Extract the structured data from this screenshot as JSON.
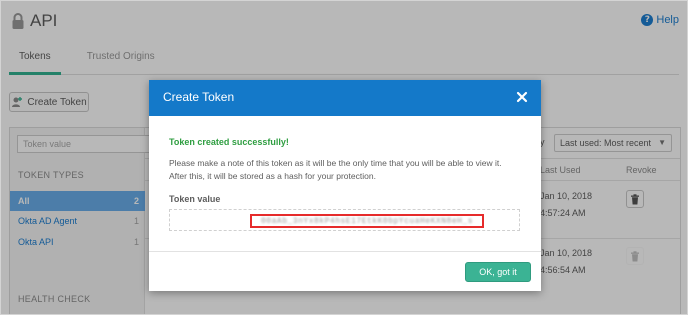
{
  "header": {
    "title": "API",
    "help_label": "Help"
  },
  "tabs": [
    {
      "label": "Tokens",
      "active": true
    },
    {
      "label": "Trusted Origins",
      "active": false
    }
  ],
  "toolbar": {
    "create_label": "Create Token"
  },
  "filters": {
    "search_placeholder": "Token value",
    "sort_prefix": "y",
    "sort_selected": "Last used: Most recent",
    "token_types_title": "TOKEN TYPES",
    "types": [
      {
        "label": "All",
        "count": "2",
        "selected": true
      },
      {
        "label": "Okta AD Agent",
        "count": "1",
        "selected": false
      },
      {
        "label": "Okta API",
        "count": "1",
        "selected": false
      }
    ],
    "health_check_title": "HEALTH CHECK"
  },
  "table": {
    "columns": {
      "last_used": "Last Used",
      "revoke": "Revoke"
    },
    "rows": [
      {
        "date": "Jan 10, 2018",
        "time": "4:57:24 AM"
      },
      {
        "date": "Jan 10, 2018",
        "time": "4:56:54 AM"
      }
    ]
  },
  "modal": {
    "title": "Create Token",
    "success": "Token created successfully!",
    "note_line1": "Please make a note of this token as it will be the only time that you will be able to view it.",
    "note_line2": "After this, it will be stored as a hash for your protection.",
    "token_label": "Token value",
    "token_value": "00aAb_3nYx8kP4hsE17EtkK0bpYcuaHeKXN8eH_s",
    "ok_label": "OK, got it"
  },
  "colors": {
    "accent": "#1479c9",
    "success": "#2f9e41",
    "ok_button": "#3bb394",
    "highlight": "#e62b2b"
  }
}
